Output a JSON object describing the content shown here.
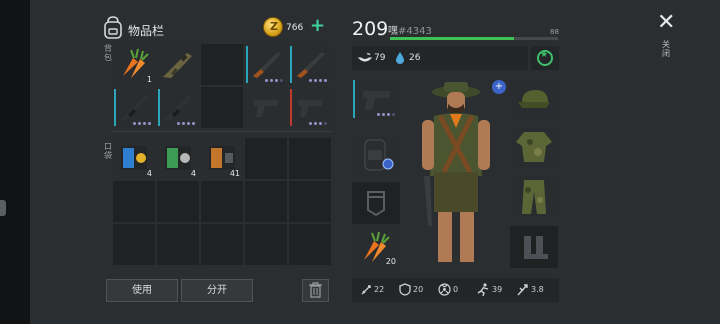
{
  "inventory": {
    "title": "物品栏",
    "coins": "766",
    "add_icon": "plus-icon",
    "section_backpack": "背包",
    "section_pockets": "口袋",
    "backpack_items": [
      {
        "icon": "carrot-icon",
        "count": "1"
      },
      {
        "icon": "assault-rifle-icon",
        "count": ""
      },
      {
        "icon": "",
        "count": ""
      },
      {
        "icon": "shotgun-icon",
        "count": ""
      },
      {
        "icon": "shotgun-icon",
        "count": ""
      },
      {
        "icon": "smg-icon",
        "count": ""
      },
      {
        "icon": "smg-icon",
        "count": ""
      },
      {
        "icon": "",
        "count": ""
      },
      {
        "icon": "pistol-icon",
        "count": ""
      },
      {
        "icon": "pistol-icon",
        "count": ""
      }
    ],
    "pocket_items": [
      {
        "icon": "recipe-book-icon",
        "count": "4"
      },
      {
        "icon": "recipe-book-icon",
        "count": "4"
      },
      {
        "icon": "recipe-book-icon",
        "count": "41"
      }
    ],
    "use_label": "使用",
    "split_label": "分开"
  },
  "player": {
    "level": "209",
    "name": "嘿",
    "id": "#4343",
    "xp_cap": "88",
    "xp_fraction": 0.74,
    "hunger": "79",
    "thirst": "26",
    "carrot_count": "20"
  },
  "bottom_stats": {
    "attack": "22",
    "defense": "20",
    "radiation": "0",
    "speed": "39",
    "stamina": "3.8"
  },
  "close_label": "关闭",
  "colors": {
    "accent_green": "#3fd49b",
    "xp_green": "#3ec255",
    "rarity_teal": "#2aa6b8",
    "rarity_red": "#c0392b"
  }
}
